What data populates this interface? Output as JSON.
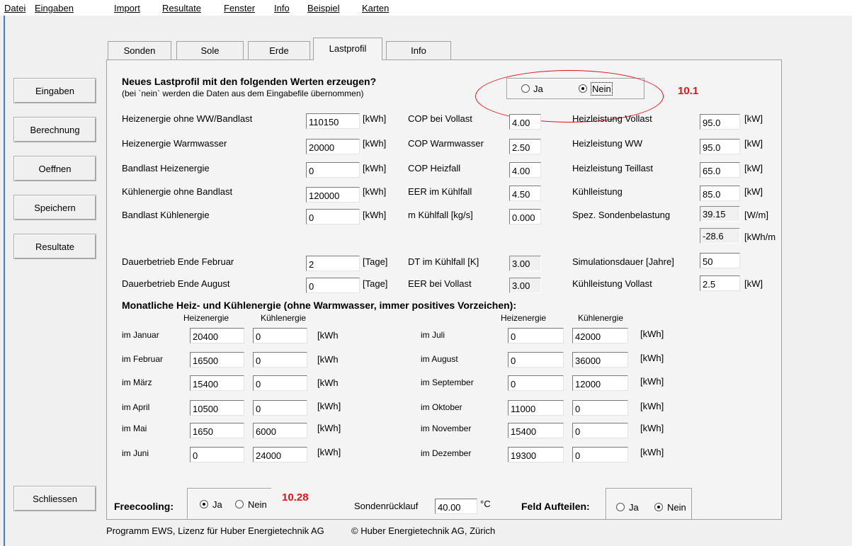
{
  "menu": [
    "Datei",
    "Eingaben",
    "Import",
    "Resultate",
    "Fenster",
    "Info",
    "Beispiel",
    "Karten"
  ],
  "sidebar": {
    "eingaben": "Eingaben",
    "berechnung": "Berechnung",
    "oeffnen": "Oeffnen",
    "speichern": "Speichern",
    "resultate": "Resultate",
    "schliessen": "Schliessen"
  },
  "tabs": [
    "Sonden",
    "Sole",
    "Erde",
    "Lastprofil",
    "Info"
  ],
  "header": {
    "title": "Neues Lastprofil mit den folgenden Werten erzeugen?",
    "subtitle": "(bei `nein` werden die Daten aus dem Eingabefile übernommen)",
    "ja": "Ja",
    "nein": "Nein",
    "annotation": "10.1"
  },
  "col1": {
    "heiz_ohne": {
      "label": "Heizenergie ohne WW/Bandlast",
      "value": "110150",
      "unit": "[kWh]"
    },
    "heiz_ww": {
      "label": "Heizenergie Warmwasser",
      "value": "20000",
      "unit": "[kWh]"
    },
    "bandlast_heiz": {
      "label": "Bandlast Heizenergie",
      "value": "0",
      "unit": "[kWh]"
    },
    "kuehl_ohne": {
      "label": "Kühlenergie ohne Bandlast",
      "value": "120000",
      "unit": "[kWh]"
    },
    "bandlast_kuehl": {
      "label": "Bandlast Kühlenergie",
      "value": "0",
      "unit": "[kWh]"
    },
    "dauer_feb": {
      "label": "Dauerbetrieb Ende Februar",
      "value": "2",
      "unit": "[Tage]"
    },
    "dauer_aug": {
      "label": "Dauerbetrieb Ende August",
      "value": "0",
      "unit": "[Tage]"
    }
  },
  "col2": {
    "cop_voll": {
      "label": "COP bei Vollast",
      "value": "4.00"
    },
    "cop_ww": {
      "label": "COP Warmwasser",
      "value": "2.50"
    },
    "cop_heiz": {
      "label": "COP Heizfall",
      "value": "4.00"
    },
    "eer_kuehl": {
      "label": "EER im Kühlfall",
      "value": "4.50"
    },
    "m_kuehl": {
      "label": "m Kühlfall [kg/s]",
      "value": "0.000"
    },
    "dt_kuehl": {
      "label": "DT im Kühlfall [K]",
      "value": "3.00"
    },
    "eer_voll": {
      "label": "EER bei Vollast",
      "value": "3.00"
    }
  },
  "col3": {
    "hl_voll": {
      "label": "Heizleistung Vollast",
      "value": "95.0",
      "unit": "[kW]"
    },
    "hl_ww": {
      "label": "Heizleistung WW",
      "value": "95.0",
      "unit": "[kW]"
    },
    "hl_teil": {
      "label": "Heizleistung Teillast",
      "value": "65.0",
      "unit": "[kW]"
    },
    "kl": {
      "label": "Kühlleistung",
      "value": "85.0",
      "unit": "[kW]"
    },
    "spez": {
      "label": "Spez. Sondenbelastung",
      "value": "39.15",
      "unit": "[W/m]"
    },
    "spez2": {
      "value": "-28.6",
      "unit": "[kWh/m"
    },
    "sim": {
      "label": "Simulationsdauer [Jahre]",
      "value": "50"
    },
    "kl_voll": {
      "label": "Kühlleistung Vollast",
      "value": "2.5",
      "unit": "[kW]"
    }
  },
  "monthly": {
    "title": "Monatliche Heiz- und Kühlenergie (ohne Warmwasser, immer positives Vorzeichen):",
    "col_heiz": "Heizenergie",
    "col_kuehl": "Kühlenergie",
    "left": [
      {
        "month": "im Januar",
        "heiz": "20400",
        "kuehl": "0",
        "unit": "[kWh"
      },
      {
        "month": "im Februar",
        "heiz": "16500",
        "kuehl": "0",
        "unit": "[kWh"
      },
      {
        "month": "im März",
        "heiz": "15400",
        "kuehl": "0",
        "unit": "[kWh"
      },
      {
        "month": "im April",
        "heiz": "10500",
        "kuehl": "0",
        "unit": "[kWh]"
      },
      {
        "month": "im Mai",
        "heiz": "1650",
        "kuehl": "6000",
        "unit": "[kWh]"
      },
      {
        "month": "im Juni",
        "heiz": "0",
        "kuehl": "24000",
        "unit": "[kWh]"
      }
    ],
    "right": [
      {
        "month": "im Juli",
        "heiz": "0",
        "kuehl": "42000",
        "unit": "[kWh]"
      },
      {
        "month": "im August",
        "heiz": "0",
        "kuehl": "36000",
        "unit": "[kWh]"
      },
      {
        "month": "im September",
        "heiz": "0",
        "kuehl": "12000",
        "unit": "[kWh]"
      },
      {
        "month": "im Oktober",
        "heiz": "11000",
        "kuehl": "0",
        "unit": "[kWh]"
      },
      {
        "month": "im November",
        "heiz": "15400",
        "kuehl": "0",
        "unit": "[kWh]"
      },
      {
        "month": "im Dezember",
        "heiz": "19300",
        "kuehl": "0",
        "unit": "[kWh]"
      }
    ]
  },
  "bottom": {
    "freecooling": "Freecooling:",
    "ja": "Ja",
    "nein": "Nein",
    "annotation": "10.28",
    "ruecklauf_label": "Sondenrücklauf",
    "ruecklauf_value": "40.00",
    "ruecklauf_unit": "°C",
    "feld_label": "Feld Aufteilen:",
    "feld_ja": "Ja",
    "feld_nein": "Nein"
  },
  "footer": {
    "program": "Programm EWS, Lizenz für Huber Energietechnik AG",
    "copyright": "© Huber Energietechnik AG, Zürich"
  },
  "colors": {
    "annotation": "#e0121b",
    "background": "#f0f0f0"
  }
}
